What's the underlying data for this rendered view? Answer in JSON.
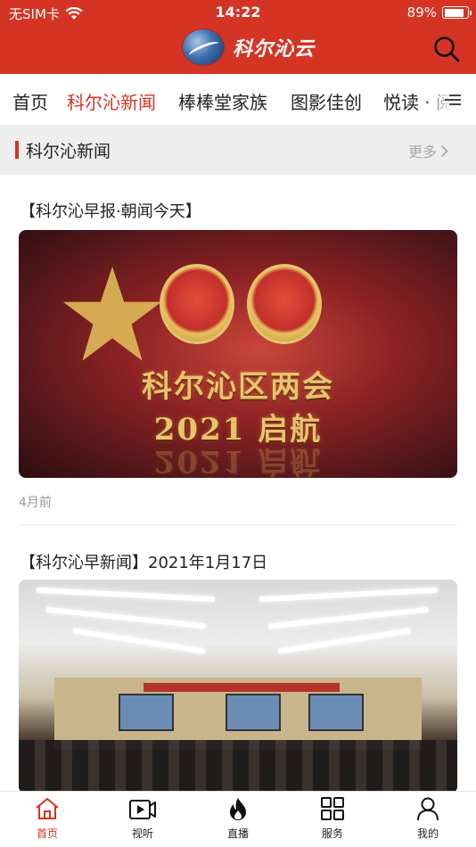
{
  "status_bar": {
    "carrier": "无SIM卡",
    "time": "14:22",
    "battery": "89%",
    "battery_level": 0.89
  },
  "header": {
    "brand": "科尔沁云",
    "search_icon": "search-icon"
  },
  "tabs": [
    {
      "label": "首页",
      "active": false
    },
    {
      "label": "科尔沁新闻",
      "active": true
    },
    {
      "label": "棒棒堂家族",
      "active": false
    },
    {
      "label": "图影佳创",
      "active": false
    },
    {
      "label": "悦读 · 阅",
      "active": false
    }
  ],
  "section": {
    "title": "科尔沁新闻",
    "more": "更多"
  },
  "articles": [
    {
      "title": "【科尔沁早报·朝闻今天】",
      "image_text_line1": "科尔沁区两会",
      "image_text_line2": "2021 启航",
      "time": "4月前"
    },
    {
      "title": "【科尔沁早新闻】2021年1月17日"
    }
  ],
  "bottom_nav": [
    {
      "label": "首页",
      "icon": "home-icon",
      "active": true
    },
    {
      "label": "视听",
      "icon": "video-icon",
      "active": false
    },
    {
      "label": "直播",
      "icon": "flame-icon",
      "active": false
    },
    {
      "label": "服务",
      "icon": "grid-icon",
      "active": false
    },
    {
      "label": "我的",
      "icon": "user-icon",
      "active": false
    }
  ],
  "colors": {
    "brand_red": "#d53424",
    "inactive_text": "#222222",
    "muted_text": "#999999"
  }
}
